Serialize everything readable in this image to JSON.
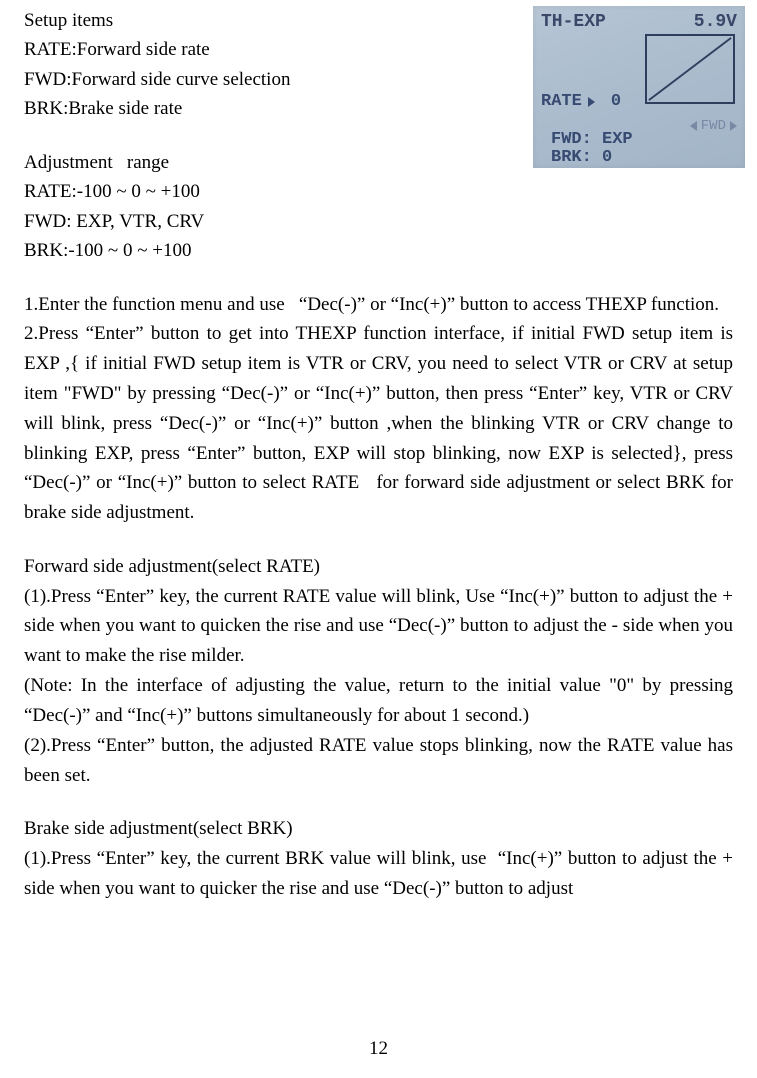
{
  "setupItems": {
    "header": "Setup items",
    "rate": "RATE:Forward side rate",
    "fwd": "FWD:Forward side curve selection",
    "brk": "BRK:Brake side rate"
  },
  "adjustment": {
    "header": "Adjustment   range",
    "rate": "RATE:-100 ~ 0 ~ +100",
    "fwd": "FWD: EXP, VTR, CRV",
    "brk": "BRK:-100 ~ 0 ~ +100"
  },
  "step1": "1.Enter the function menu and use   “Dec(-)” or “Inc(+)” button to access THEXP function.",
  "step2": "2.Press “Enter” button to get into THEXP function interface, if initial FWD setup item is EXP ,{ if initial FWD setup item is VTR or CRV, you need to select VTR or CRV at setup item \"FWD\" by pressing “Dec(-)” or “Inc(+)” button, then press “Enter” key, VTR or CRV will blink, press “Dec(-)” or “Inc(+)” button ,when the blinking VTR or CRV change to blinking EXP, press “Enter” button, EXP will stop blinking, now EXP is selected}, press “Dec(-)” or “Inc(+)” button to select RATE   for forward side adjustment or select BRK for brake side adjustment.",
  "fwdAdj": {
    "title": "Forward side adjustment(select RATE)",
    "p1": "(1).Press “Enter” key, the current RATE value will blink, Use “Inc(+)” button to adjust the + side when you want to quicken the rise and use “Dec(-)” button to adjust the - side when you want to make the rise milder.",
    "note": "(Note: In the interface of adjusting the value, return to the initial value \"0\" by pressing “Dec(-)” and “Inc(+)” buttons simultaneously for about 1 second.)",
    "p2": "(2).Press “Enter” button, the adjusted RATE value stops blinking, now the RATE value has been set."
  },
  "brkAdj": {
    "title": "Brake side adjustment(select BRK)",
    "p1": "(1).Press “Enter” key, the current BRK value will blink, use  “Inc(+)” button to adjust the + side when you want to quicker the rise and use “Dec(-)” button to adjust"
  },
  "lcd": {
    "title": "TH-EXP",
    "volt": "5.9V",
    "rateLabel": "RATE",
    "rateVal": "0",
    "fwdLine": "FWD: EXP",
    "brkLine": "BRK:   0",
    "hint": "FWD"
  },
  "pageNum": "12"
}
